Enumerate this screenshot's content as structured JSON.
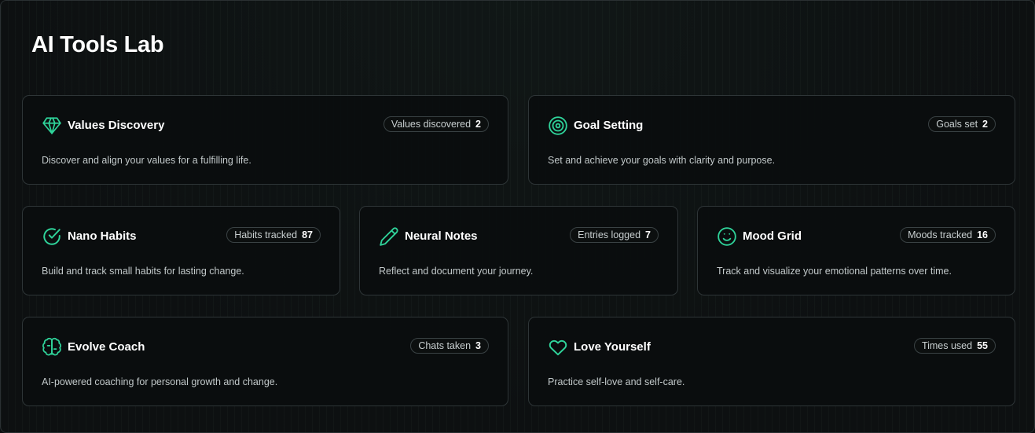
{
  "page": {
    "title": "AI Tools Lab",
    "accent_color": "#2fd39a"
  },
  "tools": [
    {
      "title": "Values Discovery",
      "icon": "diamond-icon",
      "badge_label": "Values discovered",
      "badge_count": "2",
      "description": "Discover and align your values for a fulfilling life."
    },
    {
      "title": "Goal Setting",
      "icon": "target-icon",
      "badge_label": "Goals set",
      "badge_count": "2",
      "description": "Set and achieve your goals with clarity and purpose."
    },
    {
      "title": "Nano Habits",
      "icon": "check-circle-icon",
      "badge_label": "Habits tracked",
      "badge_count": "87",
      "description": "Build and track small habits for lasting change."
    },
    {
      "title": "Neural Notes",
      "icon": "pencil-icon",
      "badge_label": "Entries logged",
      "badge_count": "7",
      "description": "Reflect and document your journey."
    },
    {
      "title": "Mood Grid",
      "icon": "smiley-icon",
      "badge_label": "Moods tracked",
      "badge_count": "16",
      "description": "Track and visualize your emotional patterns over time."
    },
    {
      "title": "Evolve Coach",
      "icon": "brain-icon",
      "badge_label": "Chats taken",
      "badge_count": "3",
      "description": "AI-powered coaching for personal growth and change."
    },
    {
      "title": "Love Yourself",
      "icon": "heart-icon",
      "badge_label": "Times used",
      "badge_count": "55",
      "description": "Practice self-love and self-care."
    }
  ]
}
